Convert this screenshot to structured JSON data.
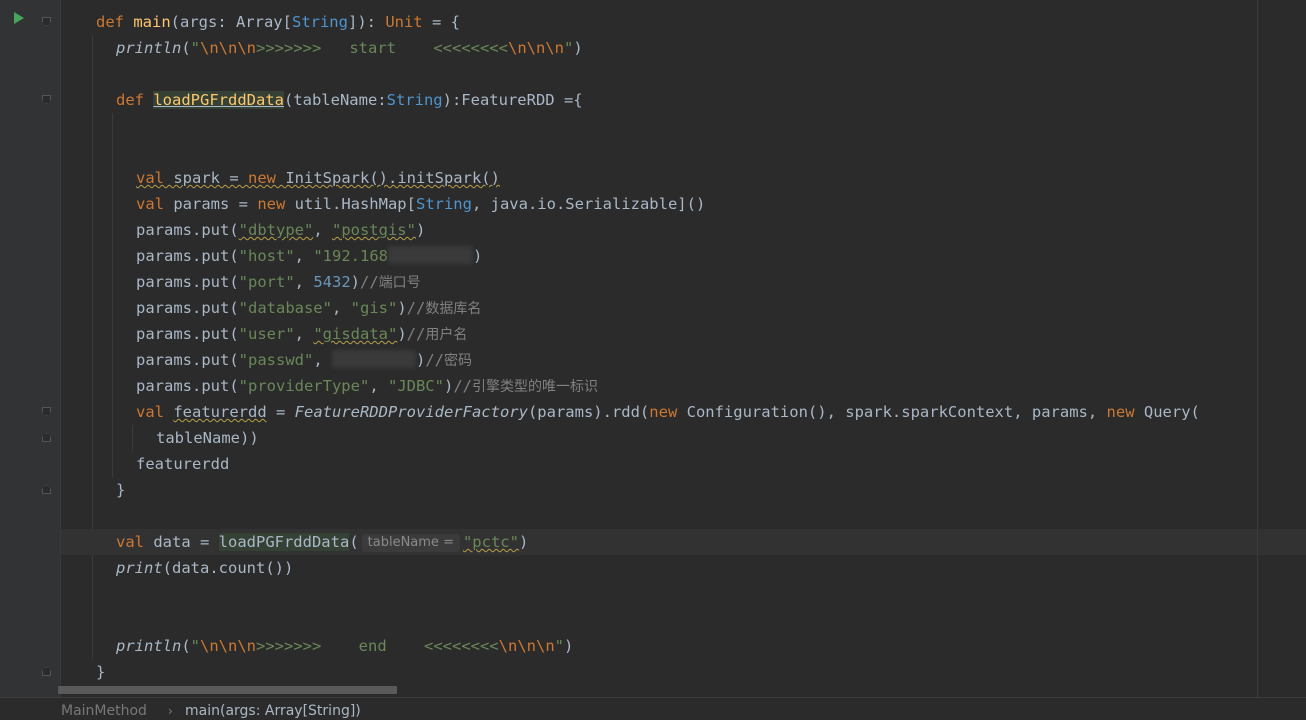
{
  "editor": {
    "lines": [
      {
        "indent": 1,
        "tokens": [
          {
            "t": "def ",
            "c": "kw"
          },
          {
            "t": "main",
            "c": "fn"
          },
          {
            "t": "(args: Array["
          },
          {
            "t": "String",
            "c": "ty"
          },
          {
            "t": "]): "
          },
          {
            "t": "Unit",
            "c": "kw"
          },
          {
            "t": " = {"
          }
        ]
      },
      {
        "indent": 2,
        "tokens": [
          {
            "t": "println",
            "c": "it"
          },
          {
            "t": "("
          },
          {
            "t": "\"",
            "c": "str"
          },
          {
            "t": "\\n\\n\\n",
            "c": "esc"
          },
          {
            "t": ">>>>>>>   start    <<<<<<<<",
            "c": "str"
          },
          {
            "t": "\\n\\n\\n",
            "c": "esc"
          },
          {
            "t": "\"",
            "c": "str"
          },
          {
            "t": ")"
          }
        ]
      },
      {
        "indent": 0,
        "tokens": []
      },
      {
        "indent": 2,
        "tokens": [
          {
            "t": "def ",
            "c": "kw"
          },
          {
            "t": "loadPGFrddData",
            "c": "fn hl ul"
          },
          {
            "t": "(tableName:"
          },
          {
            "t": "String",
            "c": "ty"
          },
          {
            "t": "):FeatureRDD ={"
          }
        ]
      },
      {
        "indent": 0,
        "tokens": []
      },
      {
        "indent": 0,
        "tokens": []
      },
      {
        "indent": 3,
        "tokens": [
          {
            "t": "val",
            "c": "kw uw"
          },
          {
            "t": " spark = ",
            "c": "uw"
          },
          {
            "t": "new",
            "c": "kw uw"
          },
          {
            "t": " InitSpark().initSpark()",
            "c": "uw"
          }
        ]
      },
      {
        "indent": 3,
        "tokens": [
          {
            "t": "val ",
            "c": "kw"
          },
          {
            "t": "params = "
          },
          {
            "t": "new ",
            "c": "kw"
          },
          {
            "t": "util.HashMap["
          },
          {
            "t": "String",
            "c": "ty"
          },
          {
            "t": ", java.io.Serializable]()"
          }
        ]
      },
      {
        "indent": 3,
        "tokens": [
          {
            "t": "params.put("
          },
          {
            "t": "\"dbtype\"",
            "c": "str uw"
          },
          {
            "t": ", "
          },
          {
            "t": "\"postgis\"",
            "c": "str uw"
          },
          {
            "t": ")"
          }
        ]
      },
      {
        "indent": 3,
        "tokens": [
          {
            "t": "params.put("
          },
          {
            "t": "\"host\"",
            "c": "str"
          },
          {
            "t": ", "
          },
          {
            "t": "\"192.168",
            "c": "str"
          },
          {
            "t": "blur",
            "c": "blur",
            "w": 85
          },
          {
            "t": ")"
          }
        ]
      },
      {
        "indent": 3,
        "tokens": [
          {
            "t": "params.put("
          },
          {
            "t": "\"port\"",
            "c": "str"
          },
          {
            "t": ", "
          },
          {
            "t": "5432",
            "c": "num"
          },
          {
            "t": ")"
          },
          {
            "t": "//",
            "c": "cm"
          },
          {
            "t": "端口号",
            "c": "cn"
          }
        ]
      },
      {
        "indent": 3,
        "tokens": [
          {
            "t": "params.put("
          },
          {
            "t": "\"database\"",
            "c": "str"
          },
          {
            "t": ", "
          },
          {
            "t": "\"gis\"",
            "c": "str"
          },
          {
            "t": ")"
          },
          {
            "t": "//",
            "c": "cm"
          },
          {
            "t": "数据库名",
            "c": "cn"
          }
        ]
      },
      {
        "indent": 3,
        "tokens": [
          {
            "t": "params.put("
          },
          {
            "t": "\"user\"",
            "c": "str"
          },
          {
            "t": ", "
          },
          {
            "t": "\"gisdata\"",
            "c": "str uw"
          },
          {
            "t": ")"
          },
          {
            "t": "//",
            "c": "cm"
          },
          {
            "t": "用户名",
            "c": "cn"
          }
        ]
      },
      {
        "indent": 3,
        "tokens": [
          {
            "t": "params.put("
          },
          {
            "t": "\"passwd\"",
            "c": "str"
          },
          {
            "t": ", "
          },
          {
            "t": "blur",
            "c": "blur",
            "w": 84
          },
          {
            "t": ")"
          },
          {
            "t": "//",
            "c": "cm"
          },
          {
            "t": "密码",
            "c": "cn"
          }
        ]
      },
      {
        "indent": 3,
        "tokens": [
          {
            "t": "params.put("
          },
          {
            "t": "\"providerType\"",
            "c": "str"
          },
          {
            "t": ", "
          },
          {
            "t": "\"JDBC\"",
            "c": "str"
          },
          {
            "t": ")"
          },
          {
            "t": "//",
            "c": "cm"
          },
          {
            "t": "引擎类型的唯一标识",
            "c": "cn"
          }
        ]
      },
      {
        "indent": 3,
        "tokens": [
          {
            "t": "val ",
            "c": "kw"
          },
          {
            "t": "featurerdd",
            "c": "uw"
          },
          {
            "t": " = "
          },
          {
            "t": "FeatureRDDProviderFactory",
            "c": "it"
          },
          {
            "t": "(params).rdd("
          },
          {
            "t": "new ",
            "c": "kw"
          },
          {
            "t": "Configuration(), spark.sparkContext, params, "
          },
          {
            "t": "new ",
            "c": "kw"
          },
          {
            "t": "Query("
          }
        ]
      },
      {
        "indent": 4,
        "tokens": [
          {
            "t": "tableName))"
          }
        ]
      },
      {
        "indent": 3,
        "tokens": [
          {
            "t": "featurerdd"
          }
        ]
      },
      {
        "indent": 2,
        "tokens": [
          {
            "t": "}"
          }
        ]
      },
      {
        "indent": 0,
        "tokens": []
      },
      {
        "indent": 2,
        "current": true,
        "tokens": [
          {
            "t": "val ",
            "c": "kw"
          },
          {
            "t": "data = "
          },
          {
            "t": "loadPGFrddData",
            "c": "hl"
          },
          {
            "t": "("
          },
          {
            "hint": "tableName ="
          },
          {
            "t": "\"pctc\"",
            "c": "str uw"
          },
          {
            "t": ")"
          }
        ]
      },
      {
        "indent": 2,
        "tokens": [
          {
            "t": "print",
            "c": "it"
          },
          {
            "t": "(data.count())"
          }
        ]
      },
      {
        "indent": 0,
        "tokens": []
      },
      {
        "indent": 0,
        "tokens": []
      },
      {
        "indent": 2,
        "tokens": [
          {
            "t": "println",
            "c": "it"
          },
          {
            "t": "("
          },
          {
            "t": "\"",
            "c": "str"
          },
          {
            "t": "\\n\\n\\n",
            "c": "esc"
          },
          {
            "t": ">>>>>>>    end    <<<<<<<<",
            "c": "str"
          },
          {
            "t": "\\n\\n\\n",
            "c": "esc"
          },
          {
            "t": "\"",
            "c": "str"
          },
          {
            "t": ")"
          }
        ]
      },
      {
        "indent": 1,
        "tokens": [
          {
            "t": "}"
          }
        ]
      }
    ]
  },
  "breadcrumb": {
    "object": "MainMethod",
    "method": "main(args: Array[String])"
  }
}
